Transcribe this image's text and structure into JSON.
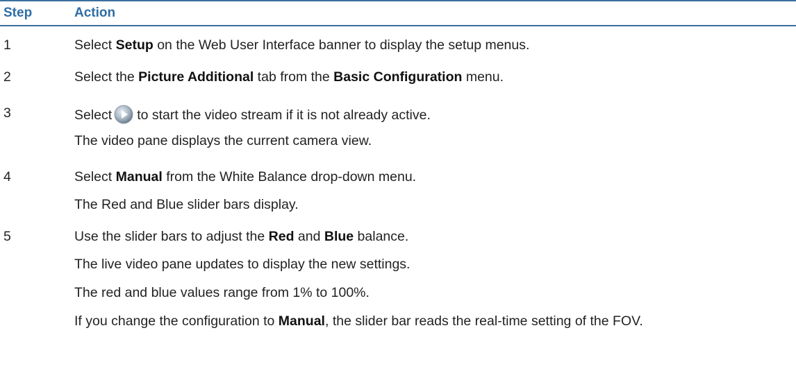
{
  "header": {
    "col_step": "Step",
    "col_action": "Action"
  },
  "rows": [
    {
      "step": "1",
      "parts": [
        "Select ",
        "Setup",
        " on the Web User Interface banner to display the setup menus."
      ]
    },
    {
      "step": "2",
      "parts": [
        "Select the ",
        "Picture Additional",
        " tab from the ",
        "Basic Configuration",
        " menu."
      ]
    },
    {
      "step": "3",
      "parts": [
        "Select",
        "to start the video stream if it is not already active."
      ],
      "icon": "play-button-icon",
      "note": "The video pane displays the current camera view."
    },
    {
      "step": "4",
      "parts": [
        "Select ",
        "Manual",
        " from the White Balance drop-down menu."
      ],
      "note": "The Red and Blue slider bars display."
    },
    {
      "step": "5",
      "parts": [
        "Use the slider bars to adjust the ",
        "Red",
        " and ",
        "Blue",
        " balance."
      ],
      "notes": [
        "The live video pane updates to display the new settings.",
        "The red and blue values range from 1% to 100%."
      ],
      "final": [
        "If you change the configuration to ",
        "Manual",
        ", the slider bar reads the real-time setting of the FOV."
      ]
    }
  ],
  "colors": {
    "header_text": "#2e6ea6",
    "rule": "#3b6e9e"
  }
}
